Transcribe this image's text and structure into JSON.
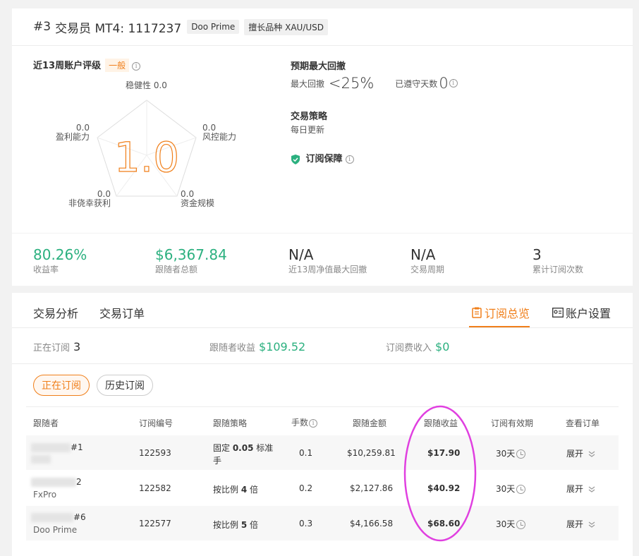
{
  "header": {
    "rank": "#3",
    "title": "交易员 MT4: 1117237",
    "broker_tag": "Doo Prime",
    "instrument_tag": "擅长品种 XAU/USD"
  },
  "rating": {
    "title": "近13周账户评级",
    "badge": "一般",
    "score": "1.0",
    "axes": {
      "stability": {
        "label": "稳健性",
        "value": "0.0"
      },
      "risk": {
        "label": "风控能力",
        "value": "0.0"
      },
      "capital": {
        "label": "资金规模",
        "value": "0.0"
      },
      "nonluck": {
        "label": "非侥幸获利",
        "value": "0.0"
      },
      "profit": {
        "label": "盈利能力",
        "value": "0.0"
      }
    }
  },
  "drawdown": {
    "title": "预期最大回撤",
    "max_label": "最大回撤",
    "max_value": "<25%",
    "days_label": "已遵守天数",
    "days_value": "0"
  },
  "strategy": {
    "title": "交易策略",
    "text": "每日更新"
  },
  "protection": {
    "label": "订阅保障"
  },
  "stats": [
    {
      "value": "80.26%",
      "label": "收益率"
    },
    {
      "value": "$6,367.84",
      "label": "跟随者总额"
    },
    {
      "value": "N/A",
      "label": "近13周净值最大回撤"
    },
    {
      "value": "N/A",
      "label": "交易周期"
    },
    {
      "value": "3",
      "label": "累计订阅次数"
    }
  ],
  "tabs": {
    "analysis": "交易分析",
    "orders": "交易订单",
    "overview": "订阅总览",
    "settings": "账户设置"
  },
  "summary": {
    "subs_label": "正在订阅",
    "subs_value": "3",
    "profit_label": "跟随者收益",
    "profit_value": "$109.52",
    "fee_label": "订阅费收入",
    "fee_value": "$0"
  },
  "filters": {
    "active": "正在订阅",
    "history": "历史订阅"
  },
  "table": {
    "headers": [
      "跟随者",
      "订阅编号",
      "跟随策略",
      "手数",
      "跟随金额",
      "跟随收益",
      "订阅有效期",
      "查看订单"
    ],
    "rows": [
      {
        "follower_suffix": "#1",
        "follower_broker": "",
        "id": "122593",
        "strategy_pre": "固定 ",
        "strategy_num": "0.05",
        "strategy_post": " 标准手",
        "lots": "0.1",
        "amount": "$10,259.81",
        "profit": "$17.90",
        "validity": "30天",
        "action": "展开"
      },
      {
        "follower_suffix": "2",
        "follower_broker": "FxPro",
        "id": "122582",
        "strategy_pre": "按比例 ",
        "strategy_num": "4",
        "strategy_post": " 倍",
        "lots": "0.2",
        "amount": "$2,127.86",
        "profit": "$40.92",
        "validity": "30天",
        "action": "展开"
      },
      {
        "follower_suffix": "#6",
        "follower_broker": "Doo Prime",
        "id": "122577",
        "strategy_pre": "按比例 ",
        "strategy_num": "5",
        "strategy_post": " 倍",
        "lots": "0.3",
        "amount": "$4,166.58",
        "profit": "$68.60",
        "validity": "30天",
        "action": "展开"
      }
    ]
  },
  "colors": {
    "accent": "#f07f1a",
    "positive": "#2bb07f",
    "highlight": "#e040e0"
  }
}
